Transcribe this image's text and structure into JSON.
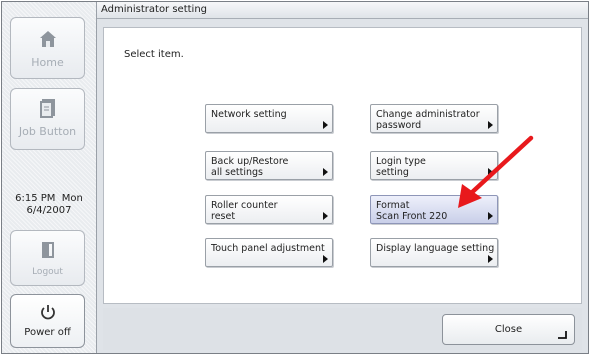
{
  "sidebar": {
    "home_label": "Home",
    "job_label": "Job Button",
    "time": "6:15 PM  Mon",
    "date": "6/4/2007",
    "logout_label": "Logout",
    "power_label": "Power off"
  },
  "window": {
    "title": "Administrator setting"
  },
  "main": {
    "prompt": "Select item.",
    "options": [
      {
        "label": "Network setting"
      },
      {
        "label": "Change administrator\npassword"
      },
      {
        "label": "Back up/Restore\nall settings"
      },
      {
        "label": "Login type\nsetting"
      },
      {
        "label": "Roller counter\nreset"
      },
      {
        "label": "Format\nScan Front 220"
      },
      {
        "label": "Touch panel adjustment"
      },
      {
        "label": "Display language setting"
      }
    ]
  },
  "footer": {
    "close_label": "Close"
  },
  "colors": {
    "highlight": "#c9cfe9",
    "annotation_arrow": "#e8191c",
    "background": "#dfe3e8"
  },
  "icons": [
    "home-icon",
    "job-button-icon",
    "logout-icon",
    "power-icon",
    "arrow-right-icon",
    "enter-icon"
  ]
}
